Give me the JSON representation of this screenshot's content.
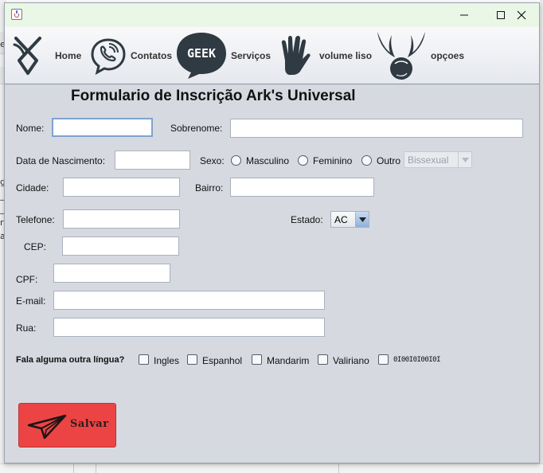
{
  "window": {
    "title": ""
  },
  "titlebar": {
    "minimize_glyph": "—",
    "maximize_glyph": "☐",
    "close_glyph": "✕"
  },
  "nav": {
    "items": [
      {
        "label": "Home",
        "icon": "rune-icon"
      },
      {
        "label": "Contatos",
        "icon": "phone-bubble-icon"
      },
      {
        "label": "Serviços",
        "icon": "geek-bubble-icon",
        "icon_text": "GEEK"
      },
      {
        "label": "volume liso",
        "icon": "vulcan-hand-icon"
      },
      {
        "label": "opçoes",
        "icon": "winged-ball-icon"
      }
    ]
  },
  "form": {
    "title": "Formulario de Inscrição Ark's Universal",
    "labels": {
      "nome": "Nome:",
      "sobrenome": "Sobrenome:",
      "nascimento": "Data de Nascimento:",
      "sexo": "Sexo:",
      "cidade": "Cidade:",
      "bairro": "Bairro:",
      "telefone": "Telefone:",
      "estado": "Estado:",
      "cep": "CEP:",
      "cpf": "CPF:",
      "email": "E-mail:",
      "rua": "Rua:",
      "lingua": "Fala alguma outra língua?"
    },
    "values": {
      "nome": "",
      "sobrenome": "",
      "nascimento": "",
      "cidade": "",
      "bairro": "",
      "telefone": "",
      "cep": "",
      "cpf": "",
      "email": "",
      "rua": ""
    },
    "sexo_options": [
      "Masculino",
      "Feminino",
      "Outro"
    ],
    "sexo_outro_select": "Bissexual",
    "estado_select": "AC",
    "languages": [
      "Ingles",
      "Espanhol",
      "Mandarim",
      "Valiriano",
      "0I00I0I00I0I"
    ],
    "save_label": "Salvar"
  },
  "colors": {
    "window_bg": "#d6d9e0",
    "titlebar_bg": "#eaf7e6",
    "save_button": "#ec4444",
    "icon_dark": "#2f3a42"
  }
}
